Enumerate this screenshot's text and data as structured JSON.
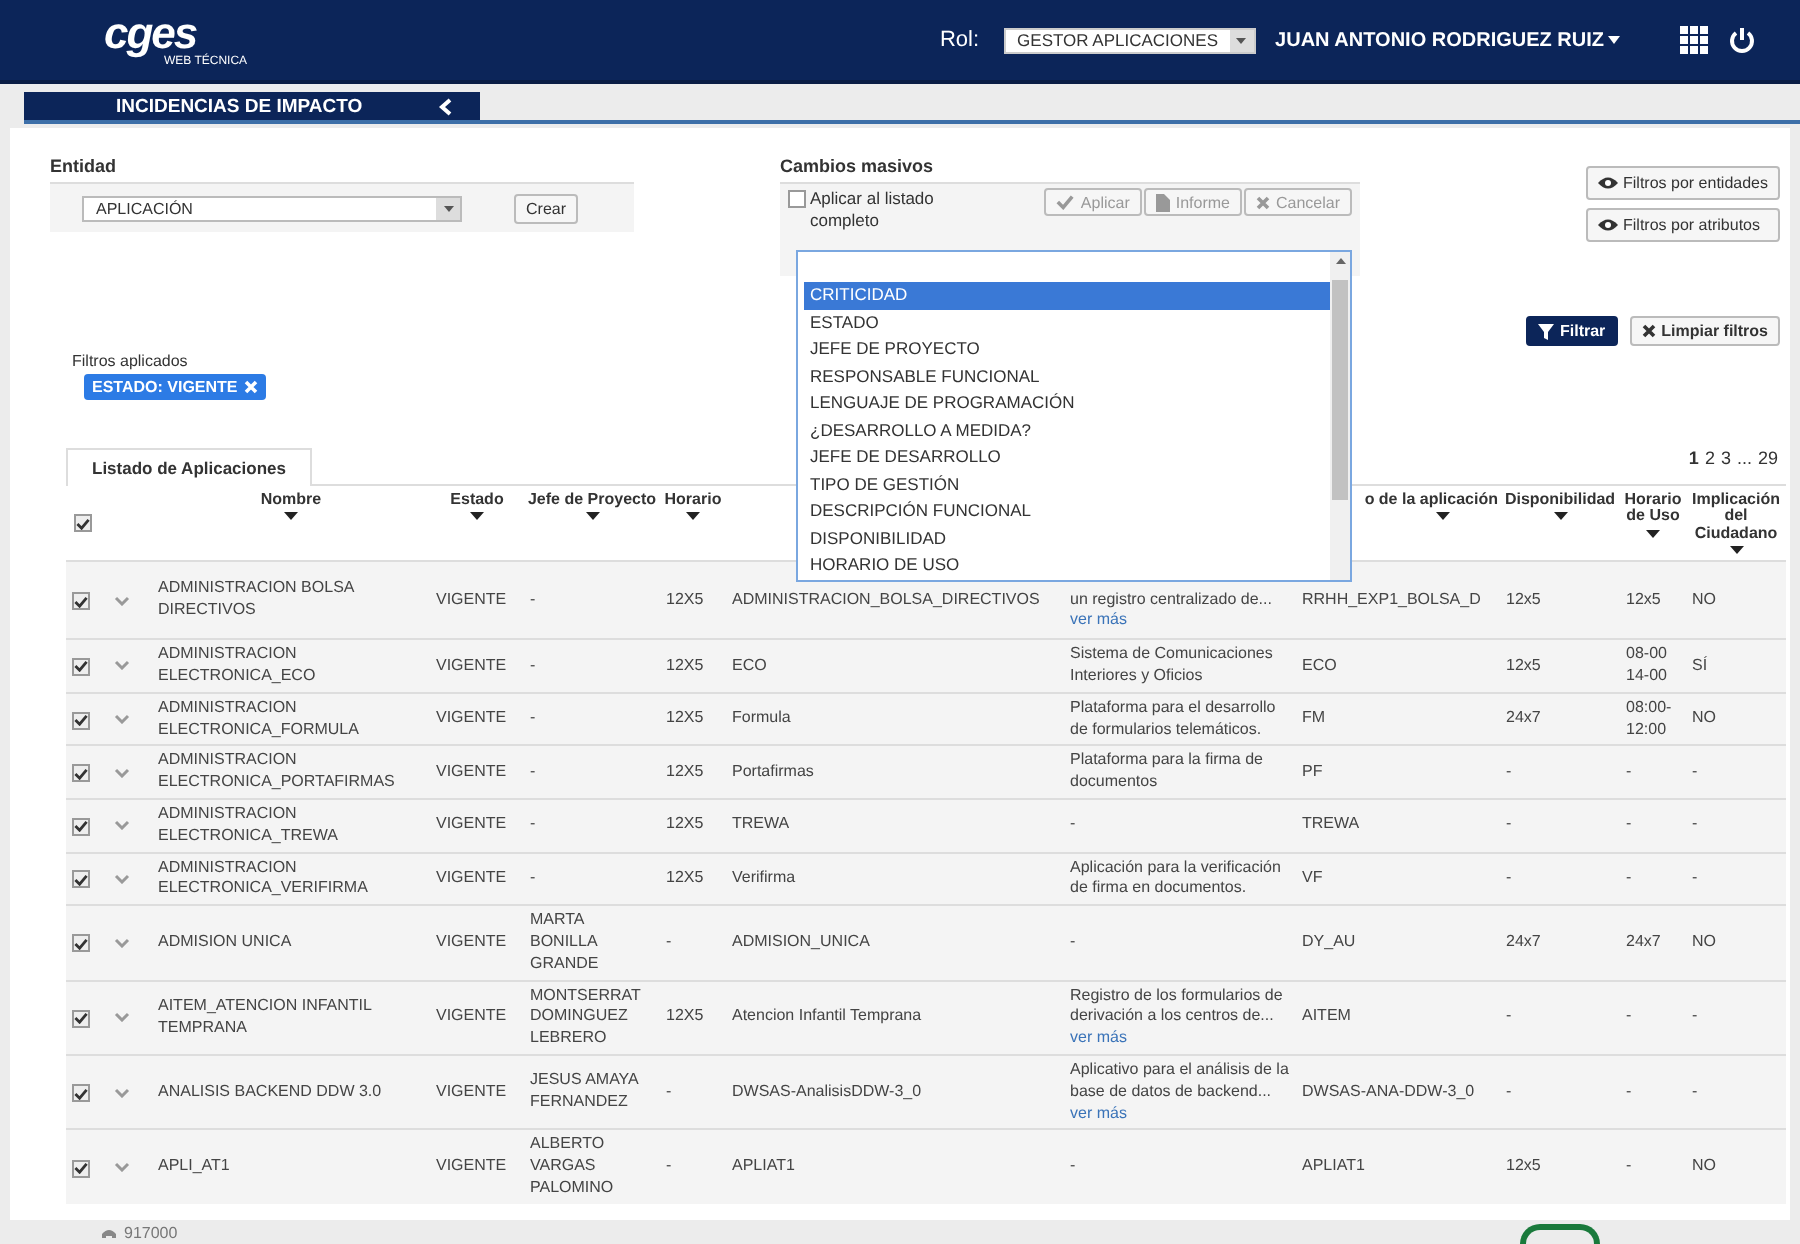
{
  "header": {
    "logo": "cges",
    "logo_sub": "WEB TÉCNICA",
    "role_label": "Rol:",
    "role_value": "GESTOR APLICACIONES",
    "user": "JUAN ANTONIO RODRIGUEZ RUIZ"
  },
  "title": "INCIDENCIAS DE IMPACTO",
  "entidad": {
    "label": "Entidad",
    "value": "APLICACIÓN",
    "create": "Crear"
  },
  "cambios": {
    "label": "Cambios masivos",
    "apply_all": "Aplicar al listado completo",
    "apply_all_checked": false,
    "buttons": [
      {
        "label": "Aplicar",
        "disabled": true
      },
      {
        "label": "Informe",
        "disabled": true
      },
      {
        "label": "Cancelar",
        "disabled": true
      }
    ],
    "options": [
      {
        "label": "CRITICIDAD",
        "selected": true
      },
      {
        "label": "ESTADO",
        "selected": false
      },
      {
        "label": "JEFE DE PROYECTO",
        "selected": false
      },
      {
        "label": "RESPONSABLE FUNCIONAL",
        "selected": false
      },
      {
        "label": "LENGUAJE DE PROGRAMACIÓN",
        "selected": false
      },
      {
        "label": "¿DESARROLLO A MEDIDA?",
        "selected": false
      },
      {
        "label": "JEFE DE DESARROLLO",
        "selected": false
      },
      {
        "label": "TIPO DE GESTIÓN",
        "selected": false
      },
      {
        "label": "DESCRIPCIÓN FUNCIONAL",
        "selected": false
      },
      {
        "label": "DISPONIBILIDAD",
        "selected": false
      },
      {
        "label": "HORARIO DE USO",
        "selected": false
      }
    ]
  },
  "filter_buttons": [
    "Filtros por entidades",
    "Filtros por atributos"
  ],
  "actions": {
    "filter": "Filtrar",
    "clear": "Limpiar filtros"
  },
  "applied": {
    "label": "Filtros aplicados",
    "tags": [
      "ESTADO: VIGENTE"
    ]
  },
  "tabs": [
    {
      "label": "Listado de Aplicaciones",
      "selected": true
    }
  ],
  "pagination": [
    {
      "label": "1",
      "selected": true
    },
    {
      "label": "2",
      "selected": false
    },
    {
      "label": "3",
      "selected": false
    },
    {
      "label": "...",
      "selected": false
    },
    {
      "label": "29",
      "selected": false
    }
  ],
  "table": {
    "all_checked": true,
    "columns": [
      "Nombre",
      "Estado",
      "Jefe de Proyecto",
      "Horario",
      null,
      null,
      "o de la aplicación",
      "Disponibilidad",
      "Horario de Uso",
      "Implicación del Ciudadano"
    ],
    "rows": [
      {
        "checked": true,
        "cells": [
          "ADMINISTRACION BOLSA DIRECTIVOS",
          "VIGENTE",
          "-",
          "12X5",
          "ADMINISTRACION_BOLSA_DIRECTIVOS",
          "un registro centralizado de...",
          "RRHH_EXP1_BOLSA_D",
          "12x5",
          "12x5",
          "NO"
        ],
        "link": "ver más"
      },
      {
        "checked": true,
        "cells": [
          "ADMINISTRACION ELECTRONICA_ECO",
          "VIGENTE",
          "-",
          "12X5",
          "ECO",
          "Sistema de Comunicaciones Interiores y Oficios",
          "ECO",
          "12x5",
          "08-00 14-00",
          "SÍ"
        ]
      },
      {
        "checked": true,
        "cells": [
          "ADMINISTRACION ELECTRONICA_FORMULA",
          "VIGENTE",
          "-",
          "12X5",
          "Formula",
          "Plataforma para el desarrollo de formularios telemáticos.",
          "FM",
          "24x7",
          "08:00-12:00",
          "NO"
        ]
      },
      {
        "checked": true,
        "cells": [
          "ADMINISTRACION ELECTRONICA_PORTAFIRMAS",
          "VIGENTE",
          "-",
          "12X5",
          "Portafirmas",
          "Plataforma para la firma de documentos",
          "PF",
          "-",
          "-",
          "-"
        ]
      },
      {
        "checked": true,
        "cells": [
          "ADMINISTRACION ELECTRONICA_TREWA",
          "VIGENTE",
          "-",
          "12X5",
          "TREWA",
          "-",
          "TREWA",
          "-",
          "-",
          "-"
        ]
      },
      {
        "checked": true,
        "cells": [
          "ADMINISTRACION ELECTRONICA_VERIFIRMA",
          "VIGENTE",
          "-",
          "12X5",
          "Verifirma",
          "Aplicación para la verificación de firma en documentos.",
          "VF",
          "-",
          "-",
          "-"
        ]
      },
      {
        "checked": true,
        "cells": [
          "ADMISION UNICA",
          "VIGENTE",
          "MARTA BONILLA GRANDE",
          "-",
          "ADMISION_UNICA",
          "-",
          "DY_AU",
          "24x7",
          "24x7",
          "NO"
        ]
      },
      {
        "checked": true,
        "cells": [
          "AITEM_ATENCION INFANTIL TEMPRANA",
          "VIGENTE",
          "MONTSERRAT DOMINGUEZ LEBRERO",
          "12X5",
          "Atencion Infantil Temprana",
          "Registro de los formularios de derivación a los centros de...",
          "AITEM",
          "-",
          "-",
          "-"
        ],
        "link": "ver más"
      },
      {
        "checked": true,
        "cells": [
          "ANALISIS BACKEND DDW 3.0",
          "VIGENTE",
          "JESUS AMAYA FERNANDEZ",
          "-",
          "DWSAS-AnalisisDDW-3_0",
          "Aplicativo para el análisis de la base de datos de backend...",
          "DWSAS-ANA-DDW-3_0",
          "-",
          "-",
          "-"
        ],
        "link": "ver más"
      },
      {
        "checked": true,
        "cells": [
          "APLI_AT1",
          "VIGENTE",
          "ALBERTO VARGAS PALOMINO",
          "-",
          "APLIAT1",
          "-",
          "APLIAT1",
          "12x5",
          "-",
          "NO"
        ]
      }
    ]
  },
  "footer": {
    "phone": "917000"
  }
}
